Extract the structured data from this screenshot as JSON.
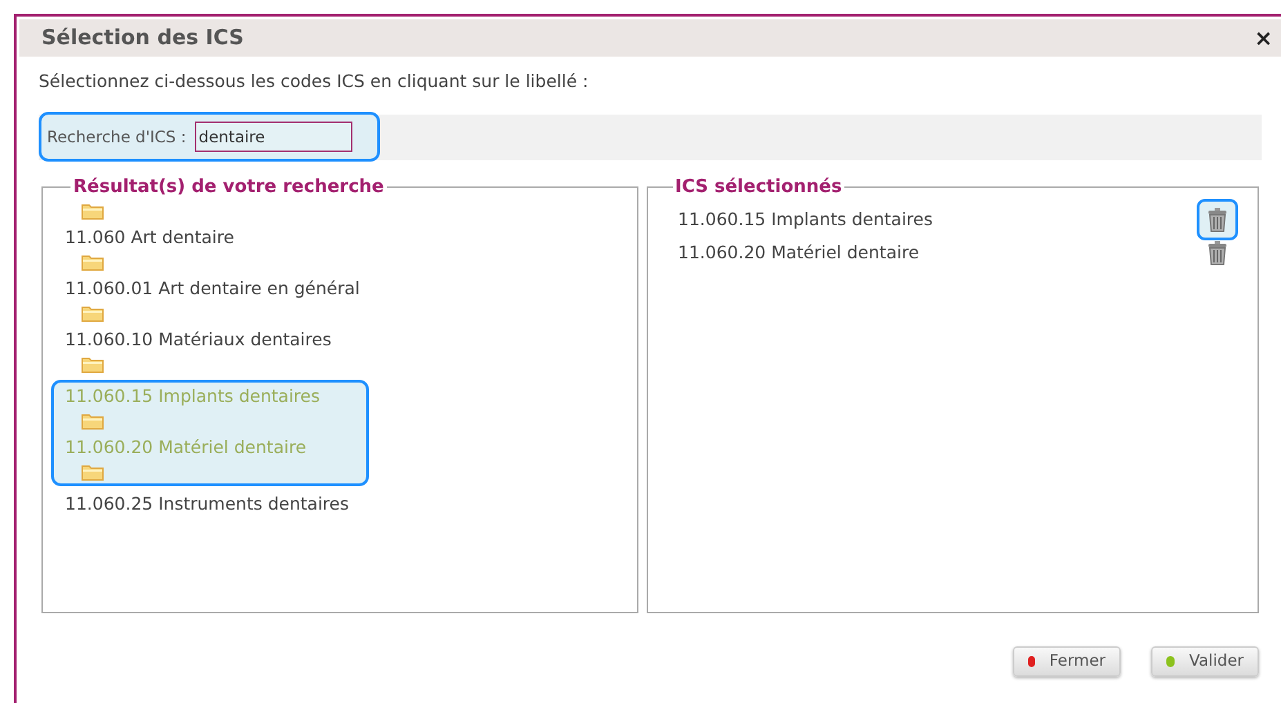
{
  "window": {
    "title": "Sélection des ICS",
    "close": "×"
  },
  "instruction": "Sélectionnez ci-dessous les codes ICS en cliquant sur le libellé :",
  "search": {
    "label": "Recherche d'ICS :",
    "value": "dentaire",
    "highlighted": true
  },
  "results": {
    "title": "Résultat(s) de votre recherche",
    "items": [
      {
        "label": "11.060 Art dentaire",
        "selected": false
      },
      {
        "label": "11.060.01 Art dentaire en général",
        "selected": false
      },
      {
        "label": "11.060.10 Matériaux dentaires",
        "selected": false
      },
      {
        "label": "11.060.15 Implants dentaires",
        "selected": true
      },
      {
        "label": "11.060.20 Matériel dentaire",
        "selected": true
      },
      {
        "label": "11.060.25 Instruments dentaires",
        "selected": false
      }
    ]
  },
  "chosen": {
    "title": "ICS sélectionnés",
    "items": [
      {
        "label": "11.060.15 Implants dentaires",
        "highlighted": true
      },
      {
        "label": "11.060.20 Matériel dentaire",
        "highlighted": false
      }
    ]
  },
  "buttons": [
    {
      "label": "Fermer",
      "color": "#e02020"
    },
    {
      "label": "Valider",
      "color": "#8cc21e"
    }
  ]
}
